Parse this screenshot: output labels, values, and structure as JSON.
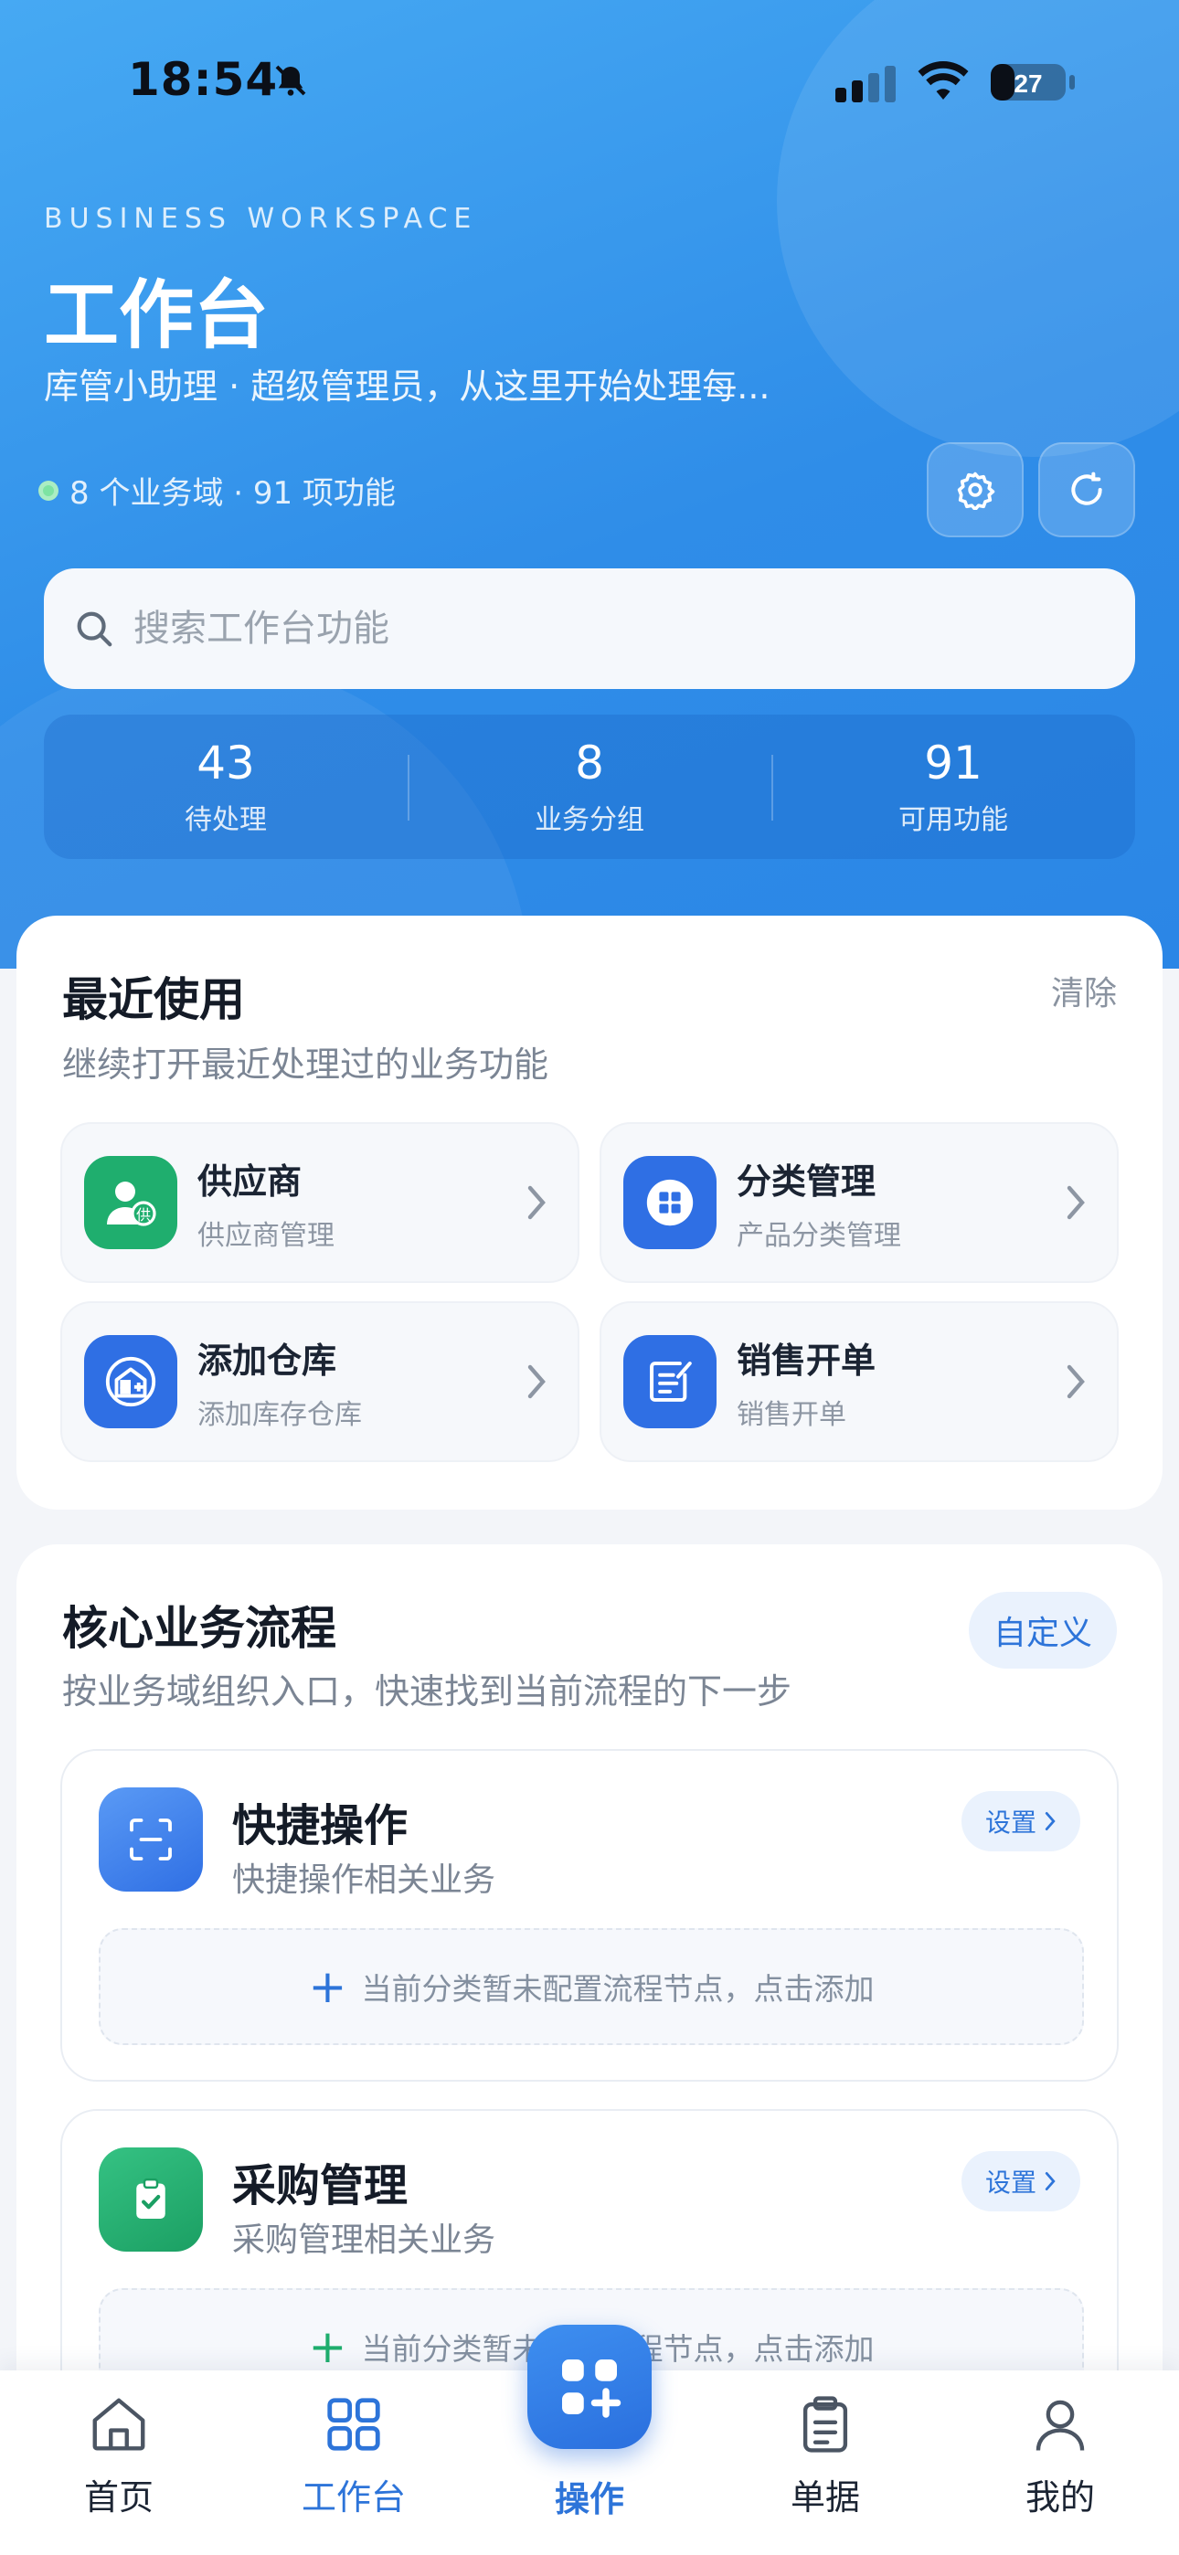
{
  "status_bar": {
    "time": "18:54",
    "battery": "27"
  },
  "hero": {
    "eyebrow": "BUSINESS WORKSPACE",
    "title": "工作台",
    "subtitle": "库管小助理 · 超级管理员，从这里开始处理每...",
    "meta": "8 个业务域 · 91 项功能"
  },
  "search": {
    "placeholder": "搜索工作台功能"
  },
  "stats": [
    {
      "value": "43",
      "label": "待处理"
    },
    {
      "value": "8",
      "label": "业务分组"
    },
    {
      "value": "91",
      "label": "可用功能"
    }
  ],
  "recent": {
    "title": "最近使用",
    "subtitle": "继续打开最近处理过的业务功能",
    "clear_label": "清除",
    "items": [
      {
        "name": "供应商",
        "desc": "供应商管理",
        "icon": "supplier-icon",
        "color": "#1fae6e"
      },
      {
        "name": "分类管理",
        "desc": "产品分类管理",
        "icon": "category-icon",
        "color": "#2f6fe4"
      },
      {
        "name": "添加仓库",
        "desc": "添加库存仓库",
        "icon": "warehouse-icon",
        "color": "#2f6fe4"
      },
      {
        "name": "销售开单",
        "desc": "销售开单",
        "icon": "sales-order-icon",
        "color": "#2f6fe4"
      }
    ]
  },
  "core": {
    "title": "核心业务流程",
    "subtitle": "按业务域组织入口，快速找到当前流程的下一步",
    "custom_label": "自定义",
    "flows": [
      {
        "name": "快捷操作",
        "desc": "快捷操作相关业务",
        "settings_label": "设置",
        "empty_text": "当前分类暂未配置流程节点，点击添加",
        "icon": "scan-icon",
        "color": "#3d82ee"
      },
      {
        "name": "采购管理",
        "desc": "采购管理相关业务",
        "settings_label": "设置",
        "empty_text": "当前分类暂未配置流程节点，点击添加",
        "icon": "clipboard-check-icon",
        "color": "#21b070"
      }
    ]
  },
  "tabbar": {
    "items": [
      {
        "label": "首页",
        "icon": "home-icon"
      },
      {
        "label": "工作台",
        "icon": "grid-icon",
        "active": true
      },
      {
        "label": "操作",
        "icon": "add-grid-icon"
      },
      {
        "label": "单据",
        "icon": "document-icon"
      },
      {
        "label": "我的",
        "icon": "user-icon"
      }
    ]
  },
  "colors": {
    "accent": "#2d74d9",
    "hero": "#3a98ee",
    "green": "#1fae6e"
  }
}
